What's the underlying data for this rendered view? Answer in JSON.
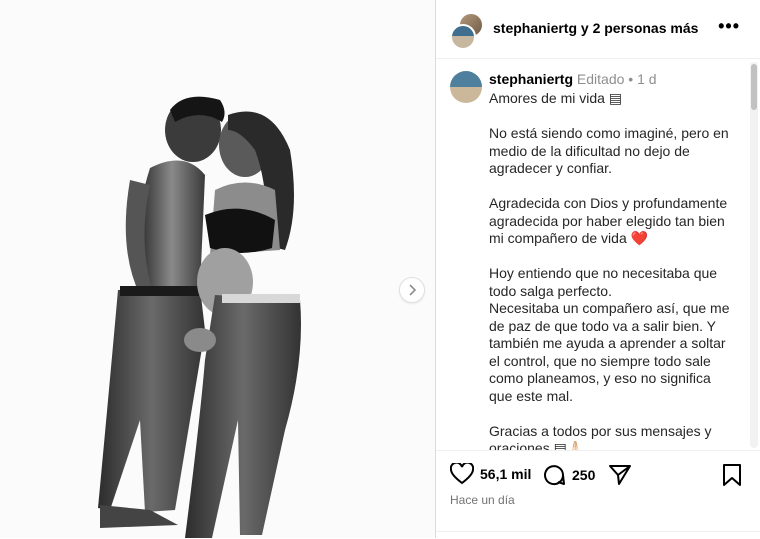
{
  "post": {
    "header": {
      "username": "stephaniertg",
      "others": " y 2 personas más",
      "more_icon": "more-horizontal-icon"
    },
    "caption": {
      "username": "stephaniertg",
      "edited": "Editado",
      "dot": "•",
      "time": "1 d",
      "paragraphs": [
        "Amores de mi vida ▤",
        "No está siendo como imaginé, pero en medio de la dificultad no dejo de agradecer y confiar.",
        "Agradecida con Dios y profundamente agradecida por haber elegido tan bien mi compañero de vida ❤️",
        "Hoy entiendo que no necesitaba que todo salga perfecto.",
        "Necesitaba un compañero así, que me de paz de que todo va a salir bien. Y también me ayuda a aprender a soltar el control, que no siempre todo sale como planeamos, y eso no significa que este mal.",
        "Gracias a todos por sus mensajes y oraciones ▤🙏🏻"
      ]
    },
    "actions": {
      "likes": "56,1 mil",
      "comments": "250",
      "timestamp": "Hace un día"
    }
  }
}
